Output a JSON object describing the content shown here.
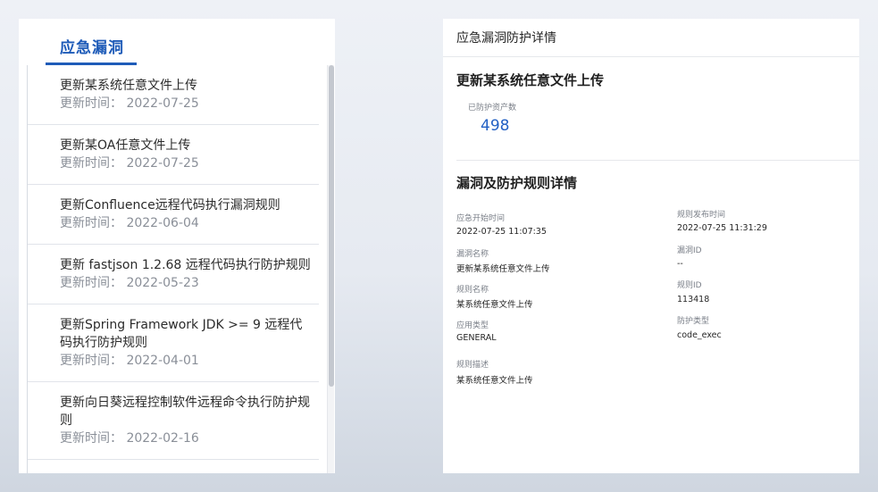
{
  "left": {
    "title": "应急漏洞",
    "items": [
      {
        "title": "更新某系统任意文件上传",
        "date": "更新时间： 2022-07-25"
      },
      {
        "title": "更新某OA任意文件上传",
        "date": "更新时间： 2022-07-25"
      },
      {
        "title": "更新Confluence远程代码执行漏洞规则",
        "date": "更新时间： 2022-06-04"
      },
      {
        "title": "更新 fastjson 1.2.68 远程代码执行防护规则",
        "date": "更新时间： 2022-05-23"
      },
      {
        "title": "更新Spring Framework JDK >= 9 远程代码执行防护规则",
        "date": "更新时间： 2022-04-01"
      },
      {
        "title": "更新向日葵远程控制软件远程命令执行防护规则",
        "date": "更新时间： 2022-02-16"
      }
    ]
  },
  "detail": {
    "header": "应急漏洞防护详情",
    "section1_title": "更新某系统任意文件上传",
    "protected_assets_label": "已防护资产数",
    "protected_assets_value": "498",
    "section2_title": "漏洞及防护规则详情",
    "fields": {
      "start_time_label": "应急开始时间",
      "start_time_value": "2022-07-25 11:07:35",
      "publish_time_label": "规则发布时间",
      "publish_time_value": "2022-07-25 11:31:29",
      "vuln_name_label": "漏洞名称",
      "vuln_name_value": "更新某系统任意文件上传",
      "vuln_id_label": "漏洞ID",
      "vuln_id_value": "--",
      "rule_name_label": "规则名称",
      "rule_name_value": "某系统任意文件上传",
      "rule_id_label": "规则ID",
      "rule_id_value": "113418",
      "app_type_label": "应用类型",
      "app_type_value": "GENERAL",
      "protect_type_label": "防护类型",
      "protect_type_value": "code_exec",
      "rule_desc_label": "规则描述",
      "rule_desc_value": "某系统任意文件上传"
    }
  }
}
